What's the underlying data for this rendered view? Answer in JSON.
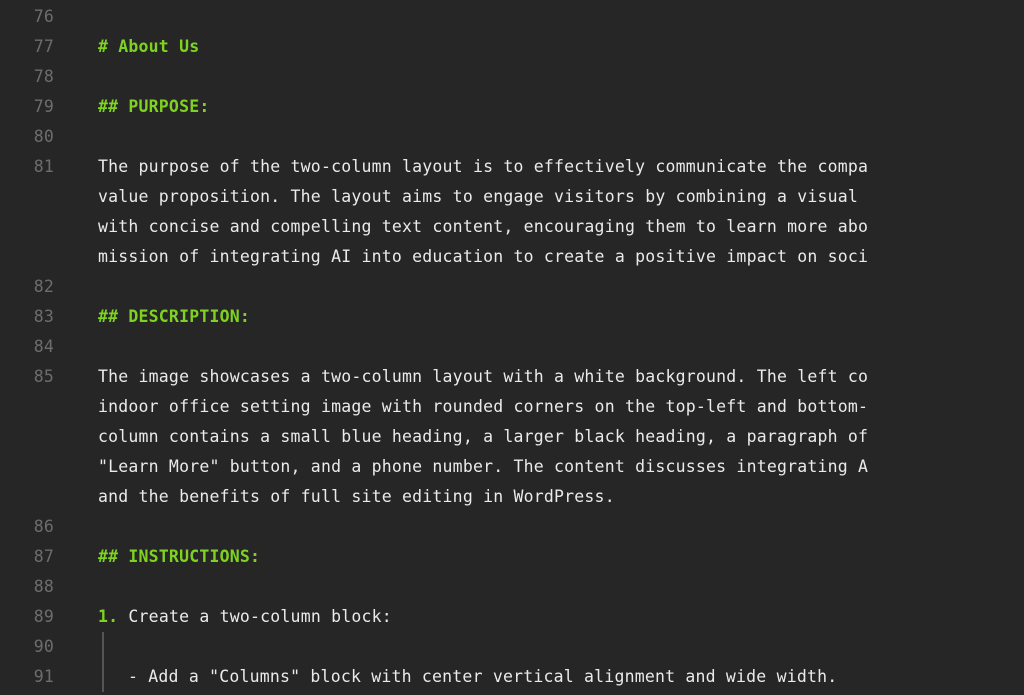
{
  "lines": {
    "76": "76",
    "77": "77",
    "78": "78",
    "79": "79",
    "80": "80",
    "81": "81",
    "82": "82",
    "83": "83",
    "84": "84",
    "85": "85",
    "86": "86",
    "87": "87",
    "88": "88",
    "89": "89",
    "90": "90",
    "91": "91"
  },
  "l77": "# About Us",
  "l79": "## PURPOSE:",
  "l81a": "The purpose of the two-column layout is to effectively communicate the compa",
  "l81b": "value proposition. The layout aims to engage visitors by combining a visual",
  "l81c": "with concise and compelling text content, encouraging them to learn more abo",
  "l81d": "mission of integrating AI into education to create a positive impact on soci",
  "l83": "## DESCRIPTION:",
  "l85a": "The image showcases a two-column layout with a white background. The left co",
  "l85b": "indoor office setting image with rounded corners on the top-left and bottom-",
  "l85c": "column contains a small blue heading, a larger black heading, a paragraph of",
  "l85d": "\"Learn More\" button, and a phone number. The content discusses integrating A",
  "l85e": "and the benefits of full site editing in WordPress.",
  "l87": "## INSTRUCTIONS:",
  "l89num": "1.",
  "l89txt": " Create a two-column block:",
  "l91bullet": "- ",
  "l91txt": "Add a \"Columns\" block with center vertical alignment and wide width."
}
